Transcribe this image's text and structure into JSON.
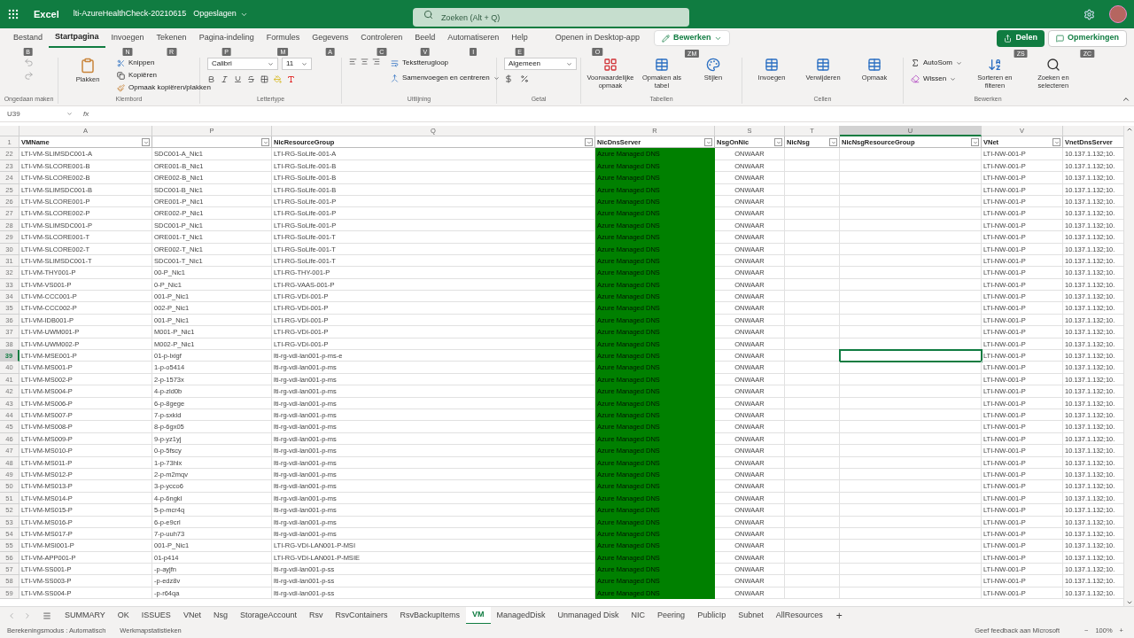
{
  "title_bar": {
    "app": "Excel",
    "file": "lti-AzureHealthCheck-20210615",
    "status": "Opgeslagen",
    "search_placeholder": "Zoeken (Alt + Q)"
  },
  "ribbon_tabs": [
    {
      "label": "Bestand",
      "selected": false,
      "keytip": "B"
    },
    {
      "label": "Startpagina",
      "selected": true
    },
    {
      "label": "Invoegen",
      "selected": false,
      "keytip": "N"
    },
    {
      "label": "Tekenen",
      "selected": false,
      "keytip": "R"
    },
    {
      "label": "Pagina-indeling",
      "selected": false,
      "keytip": "P"
    },
    {
      "label": "Formules",
      "selected": false,
      "keytip": "M"
    },
    {
      "label": "Gegevens",
      "selected": false,
      "keytip": "A"
    },
    {
      "label": "Controleren",
      "selected": false,
      "keytip": "C"
    },
    {
      "label": "Beeld",
      "selected": false,
      "keytip": "V"
    },
    {
      "label": "Automatiseren",
      "selected": false,
      "keytip": "I"
    },
    {
      "label": "Help",
      "selected": false,
      "keytip": "E"
    }
  ],
  "ribbon_actions": {
    "open_desktop": "Openen in Desktop-app",
    "open_desktop_keytip": "O",
    "edit_mode": "Bewerken",
    "edit_keytip": "ZM",
    "share": "Delen",
    "share_keytip": "ZS",
    "comments": "Opmerkingen",
    "comments_keytip": "ZC"
  },
  "ribbon": {
    "undo_group": "Ongedaan maken",
    "clipboard": {
      "paste": "Plakken",
      "cut": "Knippen",
      "copy": "Kopiëren",
      "format_painter": "Opmaak kopiëren/plakken",
      "label": "Klembord"
    },
    "font": {
      "name": "Calibri",
      "size": "11",
      "label": "Lettertype"
    },
    "alignment": {
      "wrap": "Tekstterugloop",
      "merge": "Samenvoegen en centreren",
      "label": "Uitlijning"
    },
    "number": {
      "format": "Algemeen",
      "label": "Getal"
    },
    "tables": {
      "items": [
        "Voorwaardelijke opmaak",
        "Opmaken als tabel",
        "Stijlen"
      ],
      "label": "Tabellen"
    },
    "cells": {
      "items": [
        "Invoegen",
        "Verwijderen",
        "Opmaak"
      ],
      "label": "Cellen"
    },
    "editing": {
      "autosum": "AutoSom",
      "clear": "Wissen",
      "sort": "Sorteren en filteren",
      "find": "Zoeken en selecteren",
      "label": "Bewerken"
    }
  },
  "formula_bar": {
    "name_box": "U39",
    "fx": "fx"
  },
  "columns": [
    {
      "letter": "A",
      "header": "VMName",
      "selected": false,
      "filter": true
    },
    {
      "letter": "P",
      "selected": false,
      "filter": true
    },
    {
      "letter": "Q",
      "header": "NicResourceGroup",
      "selected": false,
      "filter": true
    },
    {
      "letter": "R",
      "header": "NicDnsServer",
      "selected": false,
      "filter": true,
      "color": "#008000"
    },
    {
      "letter": "S",
      "header": "NsgOnNic",
      "selected": false,
      "filter": true
    },
    {
      "letter": "T",
      "header": "NicNsg",
      "selected": false,
      "filter": true
    },
    {
      "letter": "U",
      "header": "NicNsgResourceGroup",
      "selected": true,
      "filter": true
    },
    {
      "letter": "V",
      "header": "VNet",
      "selected": false,
      "filter": true
    },
    {
      "header": "VnetDnsServer",
      "selected": false,
      "filter": false
    }
  ],
  "header_row": "1",
  "rows": [
    {
      "num": "22",
      "vm_name": "LTI-VM-SLIMSDC001-A",
      "nic_name": "SDC001-A_Nic1",
      "nic_resource_group": "LTI-RG-SoLife-001-A",
      "nic_dns_server": "Azure Managed DNS",
      "nsg_on_nic": "ONWAAR",
      "vnet": "LTI-NW-001-P",
      "vnet_dns_server": "10.137.1.132;10.",
      "selected": false
    },
    {
      "num": "23",
      "vm_name": "LTI-VM-SLCORE001-B",
      "nic_name": "ORE001-B_Nic1",
      "nic_resource_group": "LTI-RG-SoLife-001-B",
      "nic_dns_server": "Azure Managed DNS",
      "nsg_on_nic": "ONWAAR",
      "vnet": "LTI-NW-001-P",
      "vnet_dns_server": "10.137.1.132;10.",
      "selected": false
    },
    {
      "num": "24",
      "vm_name": "LTI-VM-SLCORE002-B",
      "nic_name": "ORE002-B_Nic1",
      "nic_resource_group": "LTI-RG-SoLife-001-B",
      "nic_dns_server": "Azure Managed DNS",
      "nsg_on_nic": "ONWAAR",
      "vnet": "LTI-NW-001-P",
      "vnet_dns_server": "10.137.1.132;10.",
      "selected": false
    },
    {
      "num": "25",
      "vm_name": "LTI-VM-SLIMSDC001-B",
      "nic_name": "SDC001-B_Nic1",
      "nic_resource_group": "LTI-RG-SoLife-001-B",
      "nic_dns_server": "Azure Managed DNS",
      "nsg_on_nic": "ONWAAR",
      "vnet": "LTI-NW-001-P",
      "vnet_dns_server": "10.137.1.132;10.",
      "selected": false
    },
    {
      "num": "26",
      "vm_name": "LTI-VM-SLCORE001-P",
      "nic_name": "ORE001-P_Nic1",
      "nic_resource_group": "LTI-RG-SoLife-001-P",
      "nic_dns_server": "Azure Managed DNS",
      "nsg_on_nic": "ONWAAR",
      "vnet": "LTI-NW-001-P",
      "vnet_dns_server": "10.137.1.132;10.",
      "selected": false
    },
    {
      "num": "27",
      "vm_name": "LTI-VM-SLCORE002-P",
      "nic_name": "ORE002-P_Nic1",
      "nic_resource_group": "LTI-RG-SoLife-001-P",
      "nic_dns_server": "Azure Managed DNS",
      "nsg_on_nic": "ONWAAR",
      "vnet": "LTI-NW-001-P",
      "vnet_dns_server": "10.137.1.132;10.",
      "selected": false
    },
    {
      "num": "28",
      "vm_name": "LTI-VM-SLIMSDC001-P",
      "nic_name": "SDC001-P_Nic1",
      "nic_resource_group": "LTI-RG-SoLife-001-P",
      "nic_dns_server": "Azure Managed DNS",
      "nsg_on_nic": "ONWAAR",
      "vnet": "LTI-NW-001-P",
      "vnet_dns_server": "10.137.1.132;10.",
      "selected": false
    },
    {
      "num": "29",
      "vm_name": "LTI-VM-SLCORE001-T",
      "nic_name": "ORE001-T_Nic1",
      "nic_resource_group": "LTI-RG-SoLife-001-T",
      "nic_dns_server": "Azure Managed DNS",
      "nsg_on_nic": "ONWAAR",
      "vnet": "LTI-NW-001-P",
      "vnet_dns_server": "10.137.1.132;10.",
      "selected": false
    },
    {
      "num": "30",
      "vm_name": "LTI-VM-SLCORE002-T",
      "nic_name": "ORE002-T_Nic1",
      "nic_resource_group": "LTI-RG-SoLife-001-T",
      "nic_dns_server": "Azure Managed DNS",
      "nsg_on_nic": "ONWAAR",
      "vnet": "LTI-NW-001-P",
      "vnet_dns_server": "10.137.1.132;10.",
      "selected": false
    },
    {
      "num": "31",
      "vm_name": "LTI-VM-SLIMSDC001-T",
      "nic_name": "SDC001-T_Nic1",
      "nic_resource_group": "LTI-RG-SoLife-001-T",
      "nic_dns_server": "Azure Managed DNS",
      "nsg_on_nic": "ONWAAR",
      "vnet": "LTI-NW-001-P",
      "vnet_dns_server": "10.137.1.132;10.",
      "selected": false
    },
    {
      "num": "32",
      "vm_name": "LTI-VM-THY001-P",
      "nic_name": "00-P_Nic1",
      "nic_resource_group": "LTI-RG-THY-001-P",
      "nic_dns_server": "Azure Managed DNS",
      "nsg_on_nic": "ONWAAR",
      "vnet": "LTI-NW-001-P",
      "vnet_dns_server": "10.137.1.132;10.",
      "selected": false
    },
    {
      "num": "33",
      "vm_name": "LTI-VM-VS001-P",
      "nic_name": "0-P_Nic1",
      "nic_resource_group": "LTI-RG-VAAS-001-P",
      "nic_dns_server": "Azure Managed DNS",
      "nsg_on_nic": "ONWAAR",
      "vnet": "LTI-NW-001-P",
      "vnet_dns_server": "10.137.1.132;10.",
      "selected": false
    },
    {
      "num": "34",
      "vm_name": "LTI-VM-CCC001-P",
      "nic_name": "001-P_Nic1",
      "nic_resource_group": "LTI-RG-VDI-001-P",
      "nic_dns_server": "Azure Managed DNS",
      "nsg_on_nic": "ONWAAR",
      "vnet": "LTI-NW-001-P",
      "vnet_dns_server": "10.137.1.132;10.",
      "selected": false
    },
    {
      "num": "35",
      "vm_name": "LTI-VM-CCC002-P",
      "nic_name": "002-P_Nic1",
      "nic_resource_group": "LTI-RG-VDI-001-P",
      "nic_dns_server": "Azure Managed DNS",
      "nsg_on_nic": "ONWAAR",
      "vnet": "LTI-NW-001-P",
      "vnet_dns_server": "10.137.1.132;10.",
      "selected": false
    },
    {
      "num": "36",
      "vm_name": "LTI-VM-IDB001-P",
      "nic_name": "001-P_Nic1",
      "nic_resource_group": "LTI-RG-VDI-001-P",
      "nic_dns_server": "Azure Managed DNS",
      "nsg_on_nic": "ONWAAR",
      "vnet": "LTI-NW-001-P",
      "vnet_dns_server": "10.137.1.132;10.",
      "selected": false
    },
    {
      "num": "37",
      "vm_name": "LTI-VM-UWM001-P",
      "nic_name": "M001-P_Nic1",
      "nic_resource_group": "LTI-RG-VDI-001-P",
      "nic_dns_server": "Azure Managed DNS",
      "nsg_on_nic": "ONWAAR",
      "vnet": "LTI-NW-001-P",
      "vnet_dns_server": "10.137.1.132;10.",
      "selected": false
    },
    {
      "num": "38",
      "vm_name": "LTI-VM-UWM002-P",
      "nic_name": "M002-P_Nic1",
      "nic_resource_group": "LTI-RG-VDI-001-P",
      "nic_dns_server": "Azure Managed DNS",
      "nsg_on_nic": "ONWAAR",
      "vnet": "LTI-NW-001-P",
      "vnet_dns_server": "10.137.1.132;10.",
      "selected": false
    },
    {
      "num": "39",
      "vm_name": "LTI-VM-MSE001-P",
      "nic_name": "01-p-lxigf",
      "nic_resource_group": "lti-rg-vdi-lan001-p-ms-e",
      "nic_dns_server": "Azure Managed DNS",
      "nsg_on_nic": "ONWAAR",
      "vnet": "LTI-NW-001-P",
      "vnet_dns_server": "10.137.1.132;10.",
      "selected": true
    },
    {
      "num": "40",
      "vm_name": "LTI-VM-MS001-P",
      "nic_name": "1-p-o5414",
      "nic_resource_group": "lti-rg-vdi-lan001-p-ms",
      "nic_dns_server": "Azure Managed DNS",
      "nsg_on_nic": "ONWAAR",
      "vnet": "LTI-NW-001-P",
      "vnet_dns_server": "10.137.1.132;10.",
      "selected": false
    },
    {
      "num": "41",
      "vm_name": "LTI-VM-MS002-P",
      "nic_name": "2-p-1573x",
      "nic_resource_group": "lti-rg-vdi-lan001-p-ms",
      "nic_dns_server": "Azure Managed DNS",
      "nsg_on_nic": "ONWAAR",
      "vnet": "LTI-NW-001-P",
      "vnet_dns_server": "10.137.1.132;10.",
      "selected": false
    },
    {
      "num": "42",
      "vm_name": "LTI-VM-MS004-P",
      "nic_name": "4-p-zld0b",
      "nic_resource_group": "lti-rg-vdi-lan001-p-ms",
      "nic_dns_server": "Azure Managed DNS",
      "nsg_on_nic": "ONWAAR",
      "vnet": "LTI-NW-001-P",
      "vnet_dns_server": "10.137.1.132;10.",
      "selected": false
    },
    {
      "num": "43",
      "vm_name": "LTI-VM-MS006-P",
      "nic_name": "6-p-8gege",
      "nic_resource_group": "lti-rg-vdi-lan001-p-ms",
      "nic_dns_server": "Azure Managed DNS",
      "nsg_on_nic": "ONWAAR",
      "vnet": "LTI-NW-001-P",
      "vnet_dns_server": "10.137.1.132;10.",
      "selected": false
    },
    {
      "num": "44",
      "vm_name": "LTI-VM-MS007-P",
      "nic_name": "7-p-sxkid",
      "nic_resource_group": "lti-rg-vdi-lan001-p-ms",
      "nic_dns_server": "Azure Managed DNS",
      "nsg_on_nic": "ONWAAR",
      "vnet": "LTI-NW-001-P",
      "vnet_dns_server": "10.137.1.132;10.",
      "selected": false
    },
    {
      "num": "45",
      "vm_name": "LTI-VM-MS008-P",
      "nic_name": "8-p-6gx05",
      "nic_resource_group": "lti-rg-vdi-lan001-p-ms",
      "nic_dns_server": "Azure Managed DNS",
      "nsg_on_nic": "ONWAAR",
      "vnet": "LTI-NW-001-P",
      "vnet_dns_server": "10.137.1.132;10.",
      "selected": false
    },
    {
      "num": "46",
      "vm_name": "LTI-VM-MS009-P",
      "nic_name": "9-p-yz1yj",
      "nic_resource_group": "lti-rg-vdi-lan001-p-ms",
      "nic_dns_server": "Azure Managed DNS",
      "nsg_on_nic": "ONWAAR",
      "vnet": "LTI-NW-001-P",
      "vnet_dns_server": "10.137.1.132;10.",
      "selected": false
    },
    {
      "num": "47",
      "vm_name": "LTI-VM-MS010-P",
      "nic_name": "0-p-5fscy",
      "nic_resource_group": "lti-rg-vdi-lan001-p-ms",
      "nic_dns_server": "Azure Managed DNS",
      "nsg_on_nic": "ONWAAR",
      "vnet": "LTI-NW-001-P",
      "vnet_dns_server": "10.137.1.132;10.",
      "selected": false
    },
    {
      "num": "48",
      "vm_name": "LTI-VM-MS011-P",
      "nic_name": "1-p-73hlx",
      "nic_resource_group": "lti-rg-vdi-lan001-p-ms",
      "nic_dns_server": "Azure Managed DNS",
      "nsg_on_nic": "ONWAAR",
      "vnet": "LTI-NW-001-P",
      "vnet_dns_server": "10.137.1.132;10.",
      "selected": false
    },
    {
      "num": "49",
      "vm_name": "LTI-VM-MS012-P",
      "nic_name": "2-p-m2mqv",
      "nic_resource_group": "lti-rg-vdi-lan001-p-ms",
      "nic_dns_server": "Azure Managed DNS",
      "nsg_on_nic": "ONWAAR",
      "vnet": "LTI-NW-001-P",
      "vnet_dns_server": "10.137.1.132;10.",
      "selected": false
    },
    {
      "num": "50",
      "vm_name": "LTI-VM-MS013-P",
      "nic_name": "3-p-ycco6",
      "nic_resource_group": "lti-rg-vdi-lan001-p-ms",
      "nic_dns_server": "Azure Managed DNS",
      "nsg_on_nic": "ONWAAR",
      "vnet": "LTI-NW-001-P",
      "vnet_dns_server": "10.137.1.132;10.",
      "selected": false
    },
    {
      "num": "51",
      "vm_name": "LTI-VM-MS014-P",
      "nic_name": "4-p-6ngkl",
      "nic_resource_group": "lti-rg-vdi-lan001-p-ms",
      "nic_dns_server": "Azure Managed DNS",
      "nsg_on_nic": "ONWAAR",
      "vnet": "LTI-NW-001-P",
      "vnet_dns_server": "10.137.1.132;10.",
      "selected": false
    },
    {
      "num": "52",
      "vm_name": "LTI-VM-MS015-P",
      "nic_name": "5-p-mcr4q",
      "nic_resource_group": "lti-rg-vdi-lan001-p-ms",
      "nic_dns_server": "Azure Managed DNS",
      "nsg_on_nic": "ONWAAR",
      "vnet": "LTI-NW-001-P",
      "vnet_dns_server": "10.137.1.132;10.",
      "selected": false
    },
    {
      "num": "53",
      "vm_name": "LTI-VM-MS016-P",
      "nic_name": "6-p-e9crl",
      "nic_resource_group": "lti-rg-vdi-lan001-p-ms",
      "nic_dns_server": "Azure Managed DNS",
      "nsg_on_nic": "ONWAAR",
      "vnet": "LTI-NW-001-P",
      "vnet_dns_server": "10.137.1.132;10.",
      "selected": false
    },
    {
      "num": "54",
      "vm_name": "LTI-VM-MS017-P",
      "nic_name": "7-p-uuh73",
      "nic_resource_group": "lti-rg-vdi-lan001-p-ms",
      "nic_dns_server": "Azure Managed DNS",
      "nsg_on_nic": "ONWAAR",
      "vnet": "LTI-NW-001-P",
      "vnet_dns_server": "10.137.1.132;10.",
      "selected": false
    },
    {
      "num": "55",
      "vm_name": "LTI-VM-MSI001-P",
      "nic_name": "001-P_Nic1",
      "nic_resource_group": "LTI-RG-VDI-LAN001-P-MSI",
      "nic_dns_server": "Azure Managed DNS",
      "nsg_on_nic": "ONWAAR",
      "vnet": "LTI-NW-001-P",
      "vnet_dns_server": "10.137.1.132;10.",
      "selected": false
    },
    {
      "num": "56",
      "vm_name": "LTI-VM-APP001-P",
      "nic_name": "01-p414",
      "nic_resource_group": "LTI-RG-VDI-LAN001-P-MSIE",
      "nic_dns_server": "Azure Managed DNS",
      "nsg_on_nic": "ONWAAR",
      "vnet": "LTI-NW-001-P",
      "vnet_dns_server": "10.137.1.132;10.",
      "selected": false
    },
    {
      "num": "57",
      "vm_name": "LTI-VM-SS001-P",
      "nic_name": "-p-ayjfn",
      "nic_resource_group": "lti-rg-vdi-lan001-p-ss",
      "nic_dns_server": "Azure Managed DNS",
      "nsg_on_nic": "ONWAAR",
      "vnet": "LTI-NW-001-P",
      "vnet_dns_server": "10.137.1.132;10.",
      "selected": false
    },
    {
      "num": "58",
      "vm_name": "LTI-VM-SS003-P",
      "nic_name": "-p-edz8v",
      "nic_resource_group": "lti-rg-vdi-lan001-p-ss",
      "nic_dns_server": "Azure Managed DNS",
      "nsg_on_nic": "ONWAAR",
      "vnet": "LTI-NW-001-P",
      "vnet_dns_server": "10.137.1.132;10.",
      "selected": false
    },
    {
      "num": "59",
      "vm_name": "LTI-VM-SS004-P",
      "nic_name": "-p-r64qa",
      "nic_resource_group": "lti-rg-vdi-lan001-p-ss",
      "nic_dns_server": "Azure Managed DNS",
      "nsg_on_nic": "ONWAAR",
      "vnet": "LTI-NW-001-P",
      "vnet_dns_server": "10.137.1.132;10.",
      "selected": false
    }
  ],
  "sheet_tabs": [
    {
      "label": "SUMMARY",
      "selected": false
    },
    {
      "label": "OK",
      "selected": false
    },
    {
      "label": "ISSUES",
      "selected": false
    },
    {
      "label": "VNet",
      "selected": false
    },
    {
      "label": "Nsg",
      "selected": false
    },
    {
      "label": "StorageAccount",
      "selected": false
    },
    {
      "label": "Rsv",
      "selected": false
    },
    {
      "label": "RsvContainers",
      "selected": false
    },
    {
      "label": "RsvBackupItems",
      "selected": false
    },
    {
      "label": "VM",
      "selected": true
    },
    {
      "label": "ManagedDisk",
      "selected": false
    },
    {
      "label": "Unmanaged Disk",
      "selected": false
    },
    {
      "label": "NIC",
      "selected": false
    },
    {
      "label": "Peering",
      "selected": false
    },
    {
      "label": "PublicIp",
      "selected": false
    },
    {
      "label": "Subnet",
      "selected": false
    },
    {
      "label": "AllResources",
      "selected": false
    }
  ],
  "add_sheet": "+",
  "status_bar": {
    "calc_mode": "Berekeningsmodus : Automatisch",
    "stats": "Werkmapstatistieken",
    "feedback": "Geef feedback aan Microsoft",
    "zoom_out": "−",
    "zoom": "100%",
    "zoom_in": "+"
  }
}
